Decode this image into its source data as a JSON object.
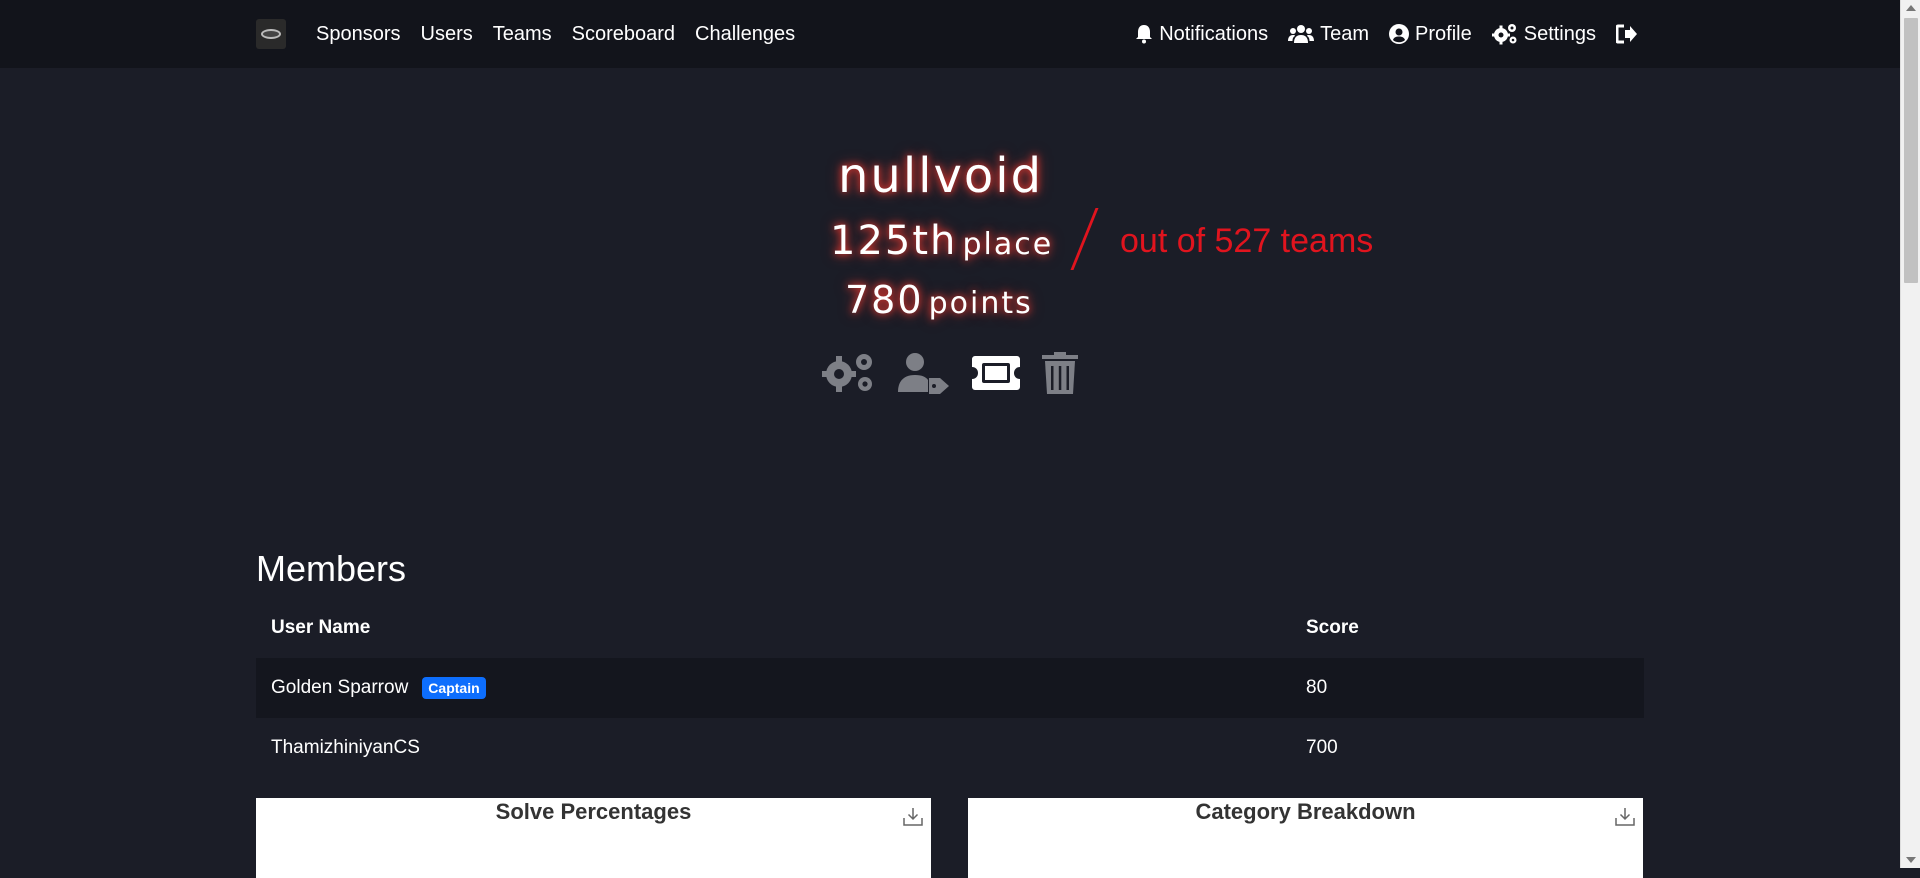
{
  "nav": {
    "left_links": [
      "Sponsors",
      "Users",
      "Teams",
      "Scoreboard",
      "Challenges"
    ],
    "notifications": "Notifications",
    "team": "Team",
    "profile": "Profile",
    "settings": "Settings"
  },
  "hero": {
    "team_name": "nullvoid",
    "place_number": "125th",
    "place_label": "place",
    "out_of": "out of 527 teams",
    "points_number": "780",
    "points_label": "points"
  },
  "members": {
    "title": "Members",
    "col_user": "User Name",
    "col_score": "Score",
    "rows": [
      {
        "name": "Golden Sparrow",
        "badge": "Captain",
        "score": "80"
      },
      {
        "name": "ThamizhiniyanCS",
        "badge": "",
        "score": "700"
      }
    ]
  },
  "charts": {
    "solve_title": "Solve Percentages",
    "category_title": "Category Breakdown"
  },
  "colors": {
    "background": "#1b1d27",
    "navbar": "#12141b",
    "accent_red": "#e0141e",
    "badge_blue": "#0d6efd"
  },
  "icons": [
    "bell-icon",
    "users-icon",
    "user-circle-icon",
    "cogs-icon",
    "sign-out-icon",
    "user-tag-icon",
    "ticket-icon",
    "trash-icon",
    "download-icon"
  ]
}
